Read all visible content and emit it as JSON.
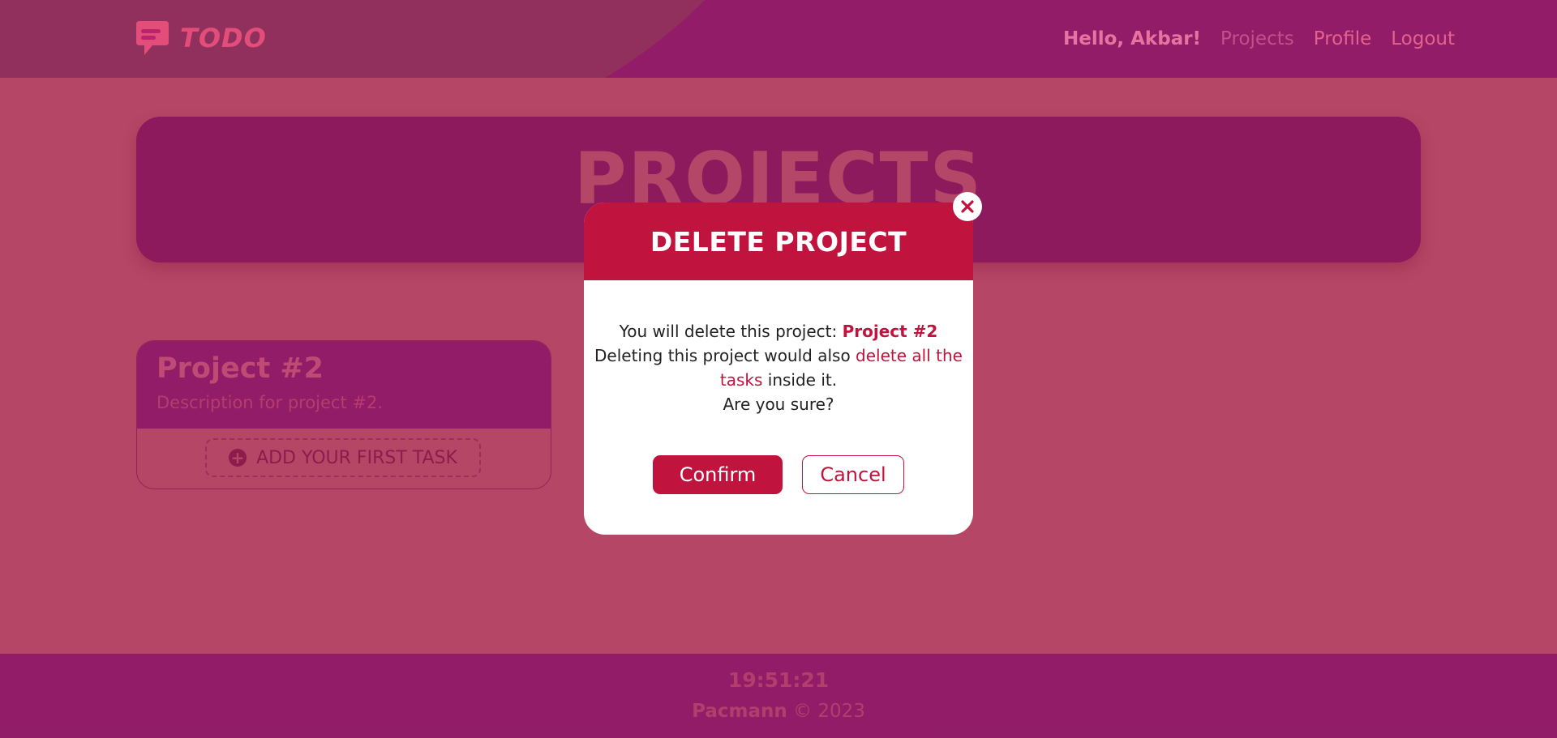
{
  "header": {
    "logo_text": "TODO",
    "greeting": "Hello, Akbar!",
    "nav": [
      "Projects",
      "Profile",
      "Logout"
    ]
  },
  "page": {
    "title": "PROJECTS"
  },
  "projects": [
    {
      "name": "Project #2",
      "description": "Description for project #2.",
      "add_task_label": "ADD YOUR FIRST TASK"
    }
  ],
  "modal": {
    "title": "DELETE PROJECT",
    "line1_prefix": "You will delete this project:",
    "project_name": "Project #2",
    "line2_prefix": "Deleting this project would also",
    "line2_warning": "delete all the tasks",
    "line2_suffix": "inside it.",
    "question": "Are you sure?",
    "confirm_label": "Confirm",
    "cancel_label": "Cancel"
  },
  "footer": {
    "time": "19:51:21",
    "brand": "Pacmann",
    "copyright": "© 2023"
  },
  "colors": {
    "primary": "#c0133d",
    "header_bg": "#a41f7e",
    "page_bg": "#d4577a"
  }
}
